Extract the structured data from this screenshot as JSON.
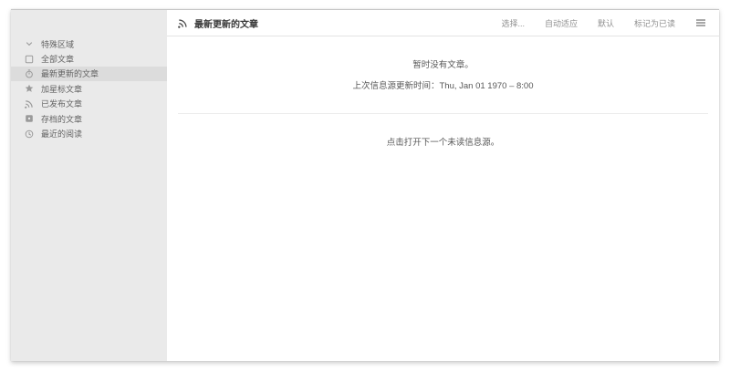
{
  "sidebar": {
    "items": [
      {
        "label": "特殊区域",
        "icon": "chevron-down-icon",
        "selected": false
      },
      {
        "label": "全部文章",
        "icon": "square-icon",
        "selected": false
      },
      {
        "label": "最新更新的文章",
        "icon": "recent-update-icon",
        "selected": true
      },
      {
        "label": "加星标文章",
        "icon": "star-icon",
        "selected": false
      },
      {
        "label": "已发布文章",
        "icon": "rss-icon",
        "selected": false
      },
      {
        "label": "存档的文章",
        "icon": "archive-icon",
        "selected": false
      },
      {
        "label": "最近的阅读",
        "icon": "history-clock-icon",
        "selected": false
      }
    ]
  },
  "header": {
    "title": "最新更新的文章",
    "title_icon": "rss-icon",
    "actions": [
      {
        "label": "选择..."
      },
      {
        "label": "自动适应"
      },
      {
        "label": "默认"
      },
      {
        "label": "标记为已读"
      }
    ],
    "menu_icon": "hamburger-menu-icon"
  },
  "content": {
    "empty_title": "暂时没有文章。",
    "last_update": "上次信息源更新时间：Thu, Jan 01 1970 – 8:00",
    "next_hint": "点击打开下一个未读信息源。"
  },
  "colors": {
    "sidebar_bg": "#eaeaea",
    "sidebar_selected_bg": "#dcdcdc",
    "main_bg": "#ffffff",
    "text_primary": "#3a3a3a",
    "text_secondary": "#585858",
    "text_muted": "#919191",
    "divider": "#ededed"
  }
}
